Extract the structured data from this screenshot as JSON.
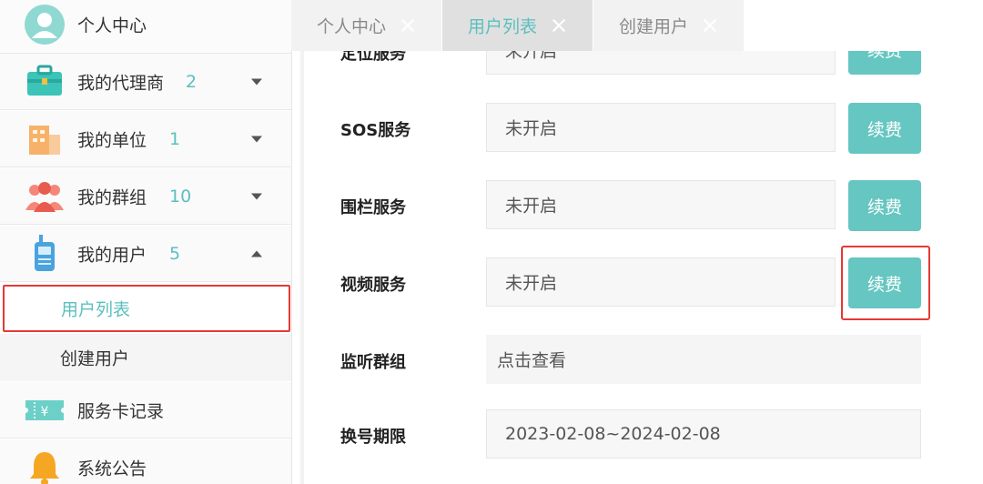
{
  "sidebar": {
    "profile": {
      "label": "个人中心"
    },
    "items": [
      {
        "label": "我的代理商",
        "count": "2"
      },
      {
        "label": "我的单位",
        "count": "1"
      },
      {
        "label": "我的群组",
        "count": "10"
      },
      {
        "label": "我的用户",
        "count": "5"
      }
    ],
    "sub_items": [
      {
        "label": "用户列表"
      },
      {
        "label": "创建用户"
      }
    ],
    "service_card": {
      "label": "服务卡记录"
    },
    "announcement": {
      "label": "系统公告"
    }
  },
  "tabs": [
    {
      "label": "个人中心"
    },
    {
      "label": "用户列表"
    },
    {
      "label": "创建用户"
    }
  ],
  "form": {
    "rows": [
      {
        "label": "定位服务",
        "value": "未开启",
        "button": "续费"
      },
      {
        "label": "SOS服务",
        "value": "未开启",
        "button": "续费"
      },
      {
        "label": "围栏服务",
        "value": "未开启",
        "button": "续费"
      },
      {
        "label": "视频服务",
        "value": "未开启",
        "button": "续费"
      }
    ],
    "monitor_group": {
      "label": "监听群组",
      "value": "点击查看"
    },
    "number_period": {
      "label": "换号期限",
      "value": "2023-02-08~2024-02-08"
    }
  },
  "colors": {
    "accent": "#5cbfbf",
    "button": "#66c6c1",
    "highlight": "#e53935"
  }
}
